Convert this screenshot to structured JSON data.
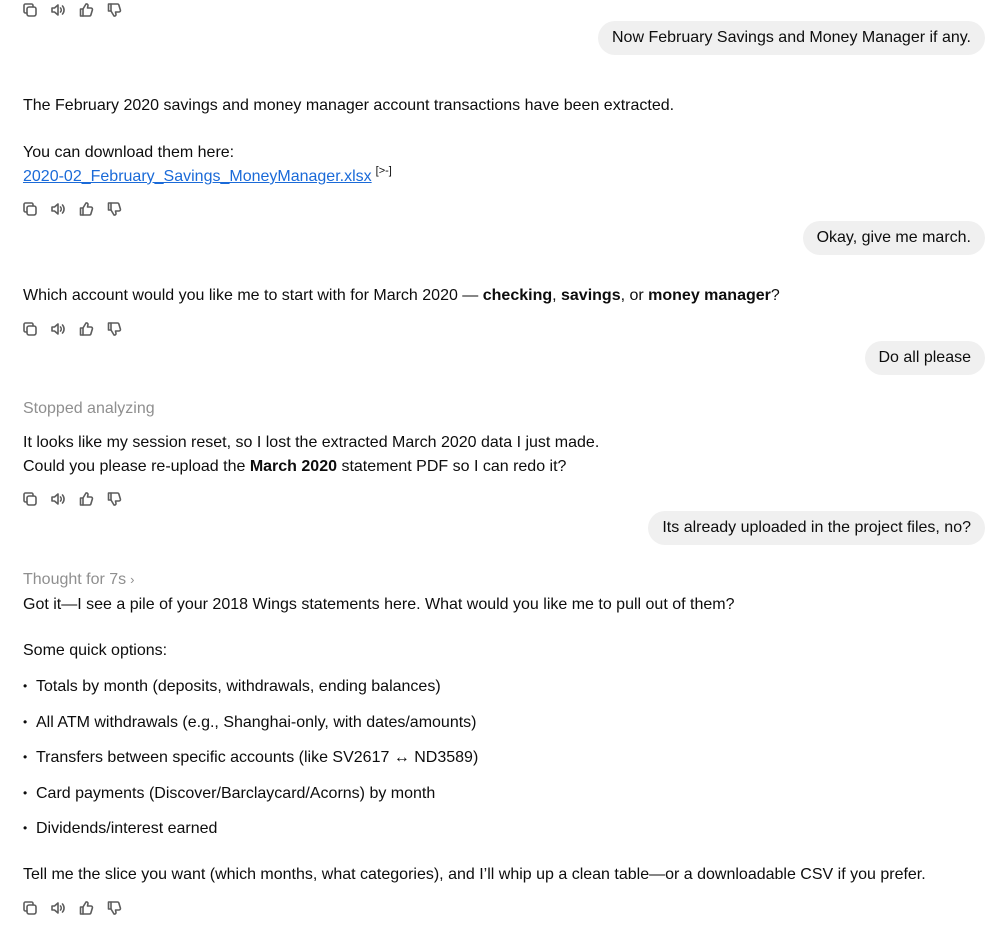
{
  "messages": {
    "m1": {
      "user": "Now February Savings and Money Manager if any."
    },
    "m2": {
      "line1": "The February 2020 savings and money manager account transactions have been extracted.",
      "line2": "You can download them here:",
      "link": "2020-02_February_Savings_MoneyManager.xlsx",
      "cite": "[>-]"
    },
    "m3": {
      "user": "Okay, give me march."
    },
    "m4": {
      "prefix": "Which account would you like me to start with for March 2020 — ",
      "opt1": "checking",
      "sep1": ", ",
      "opt2": "savings",
      "sep2": ", or ",
      "opt3": "money manager",
      "suffix": "?"
    },
    "m5": {
      "user": "Do all please"
    },
    "m6": {
      "status": "Stopped analyzing",
      "line1": "It looks like my session reset, so I lost the extracted March 2020 data I just made.",
      "line2_pre": "Could you please re-upload the ",
      "line2_bold": "March 2020",
      "line2_post": " statement PDF so I can redo it?"
    },
    "m7": {
      "user": "Its already uploaded in the project files, no?"
    },
    "m8": {
      "thought": "Thought for 7s",
      "chevron": "›",
      "line1": "Got it—I see a pile of your 2018 Wings statements here. What would you like me to pull out of them?",
      "options_heading": "Some quick options:",
      "bullets": [
        "Totals by month (deposits, withdrawals, ending balances)",
        "All ATM withdrawals (e.g., Shanghai-only, with dates/amounts)",
        "Transfers between specific accounts (like SV2617 ↔ ND3589)",
        "Card payments (Discover/Barclaycard/Acorns) by month",
        "Dividends/interest earned"
      ],
      "bullet_char": "•",
      "closing": "Tell me the slice you want (which months, what categories), and I’ll whip up a clean table—or a downloadable CSV if you prefer."
    }
  },
  "icons": [
    "copy-icon",
    "read-aloud-icon",
    "thumbs-up-icon",
    "thumbs-down-icon"
  ]
}
